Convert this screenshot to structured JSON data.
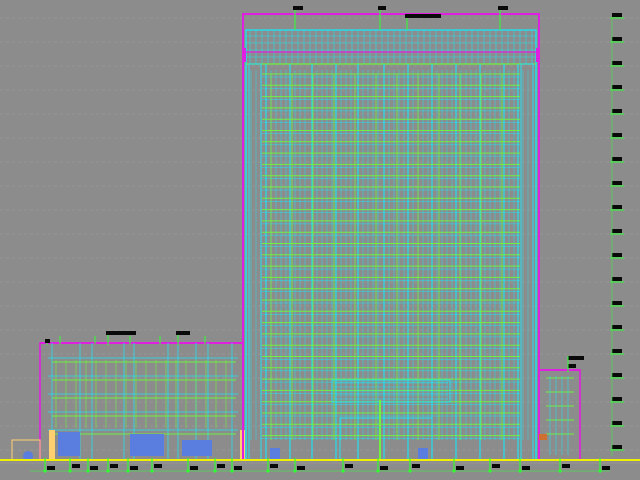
{
  "drawing": {
    "background": "#8c8c8c",
    "colors": {
      "outline": "#e020e0",
      "facade_cyan": "#22e0f0",
      "facade_green": "#70f040",
      "ground": "#f0f000",
      "dimension": "#30ff30",
      "window_blue": "#5a7ee0",
      "dark_tag": "#0a0a0a",
      "guide": "#a0a0a0",
      "accent": "#ffd070"
    },
    "icons": [
      "elevation-drawing",
      "level-marker",
      "dimension-tick"
    ]
  }
}
